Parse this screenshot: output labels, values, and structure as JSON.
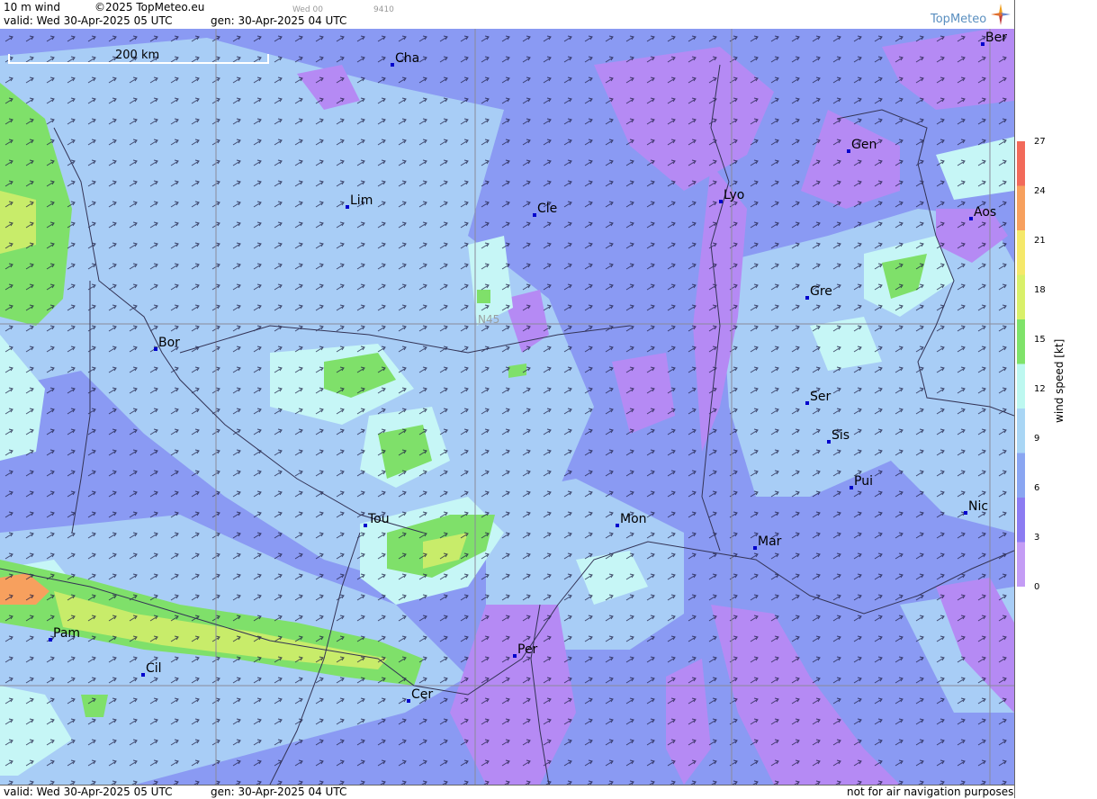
{
  "header": {
    "title": "10 m wind",
    "copyright": "©2025 TopMeteo.eu",
    "valid_label": "valid:  Wed  30-Apr-2025  05 UTC",
    "gen_label": "gen: 30-Apr-2025 04 UTC",
    "small_1": "Wed 00",
    "small_2": "9410",
    "brand": "TopMeteo"
  },
  "footer": {
    "valid_label": "valid:  Wed  30-Apr-2025  05 UTC",
    "gen_label": "gen: 30-Apr-2025 04 UTC",
    "disclaimer": "not for air navigation purposes"
  },
  "map": {
    "scale_label": "200 km",
    "lat_label": "N45",
    "cities": [
      {
        "name": "Cha"
      },
      {
        "name": "Lim"
      },
      {
        "name": "Cle"
      },
      {
        "name": "Lyo"
      },
      {
        "name": "Gen"
      },
      {
        "name": "Ber"
      },
      {
        "name": "Aos"
      },
      {
        "name": "Gre"
      },
      {
        "name": "Bor"
      },
      {
        "name": "Ser"
      },
      {
        "name": "Sis"
      },
      {
        "name": "Pui"
      },
      {
        "name": "Nic"
      },
      {
        "name": "Mon"
      },
      {
        "name": "Mar"
      },
      {
        "name": "Tou"
      },
      {
        "name": "Pam"
      },
      {
        "name": "Cil"
      },
      {
        "name": "Per"
      },
      {
        "name": "Cer"
      }
    ]
  },
  "legend": {
    "title": "wind speed [kt]",
    "ticks": [
      "27",
      "24",
      "21",
      "18",
      "15",
      "12",
      "9",
      "6",
      "3",
      "0"
    ],
    "colors": [
      "#f26a5a",
      "#f7a05e",
      "#f5e86a",
      "#d9f06a",
      "#7fe36a",
      "#bdf8f0",
      "#a9d6f5",
      "#8aa6f2",
      "#8c7cf2",
      "#c49cf5"
    ]
  },
  "colors": {
    "base": "#8a9af3",
    "light_blue": "#a8cdf6",
    "cyan": "#c6f6f6",
    "green": "#7fe06a",
    "yellow_green": "#c8ec6a",
    "purple": "#b58af4",
    "orange": "#f7a05e"
  }
}
